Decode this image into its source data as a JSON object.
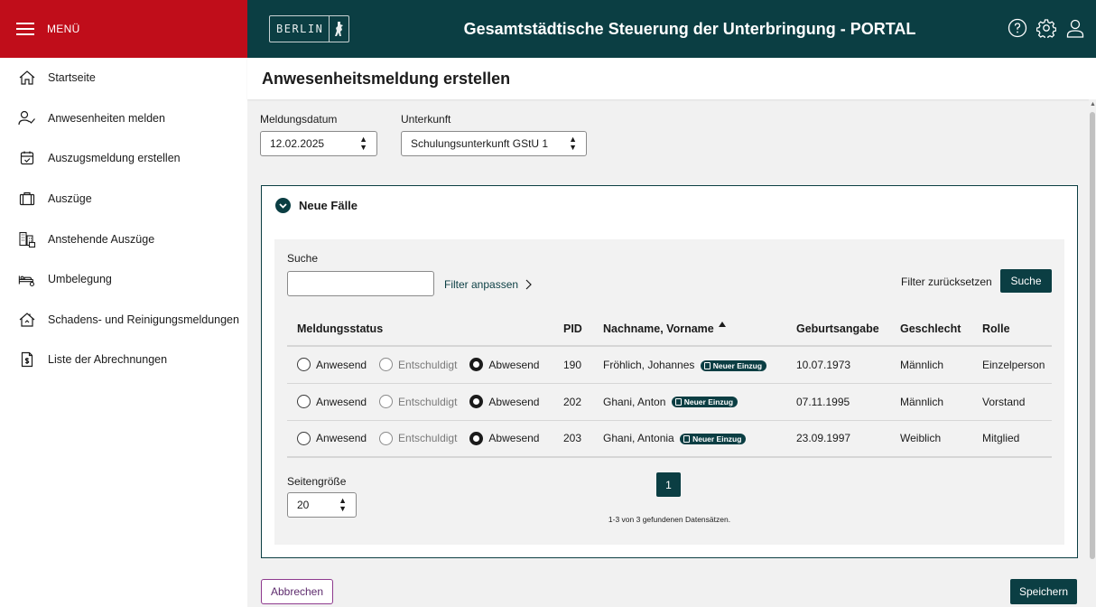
{
  "header": {
    "menu_label": "MENÜ",
    "logo_text": "BERLIN",
    "portal_title": "Gesamtstädtische Steuerung der Unterbringung - PORTAL",
    "icons": [
      "help-icon",
      "settings-icon",
      "user-icon"
    ],
    "colors": {
      "menu_bg": "#c00d1a",
      "bar_bg": "#0b3e43"
    }
  },
  "sidebar": {
    "items": [
      {
        "label": "Startseite",
        "icon": "home-icon"
      },
      {
        "label": "Anwesenheiten melden",
        "icon": "user-check-icon"
      },
      {
        "label": "Auszugsmeldung erstellen",
        "icon": "calendar-check-icon"
      },
      {
        "label": "Auszüge",
        "icon": "briefcase-icon"
      },
      {
        "label": "Anstehende Auszüge",
        "icon": "buildings-icon"
      },
      {
        "label": "Umbelegung",
        "icon": "bed-icon"
      },
      {
        "label": "Schadens- und Reinigungsmeldungen",
        "icon": "house-repair-icon"
      },
      {
        "label": "Liste der Abrechnungen",
        "icon": "invoice-icon"
      }
    ]
  },
  "main": {
    "page_title": "Anwesenheitsmeldung erstellen",
    "date_label": "Meldungsdatum",
    "date_value": "12.02.2025",
    "accommodation_label": "Unterkunft",
    "accommodation_value": "Schulungsunterkunft GStU 1",
    "section_title": "Neue Fälle",
    "search_label": "Suche",
    "search_value": "",
    "filter_link": "Filter anpassen",
    "reset_link": "Filter zurücksetzen",
    "search_button": "Suche",
    "table": {
      "columns": [
        "Meldungsstatus",
        "PID",
        "Nachname, Vorname",
        "Geburtsangabe",
        "Geschlecht",
        "Rolle"
      ],
      "radio_labels": [
        "Anwesend",
        "Entschuldigt",
        "Abwesend"
      ],
      "rows": [
        {
          "status": "Abwesend",
          "pid": "190",
          "name": "Fröhlich, Johannes",
          "badge": "Neuer Einzug",
          "birth": "10.07.1973",
          "gender": "Männlich",
          "role": "Einzelperson"
        },
        {
          "status": "Abwesend",
          "pid": "202",
          "name": "Ghani, Anton",
          "badge": "Neuer Einzug",
          "birth": "07.11.1995",
          "gender": "Männlich",
          "role": "Vorstand"
        },
        {
          "status": "Abwesend",
          "pid": "203",
          "name": "Ghani, Antonia",
          "badge": "Neuer Einzug",
          "birth": "23.09.1997",
          "gender": "Weiblich",
          "role": "Mitglied"
        }
      ]
    },
    "page_size_label": "Seitengröße",
    "page_size_value": "20",
    "current_page": "1",
    "result_count": "1-3 von 3 gefundenen Datensätzen.",
    "cancel_button": "Abbrechen",
    "save_button": "Speichern"
  }
}
